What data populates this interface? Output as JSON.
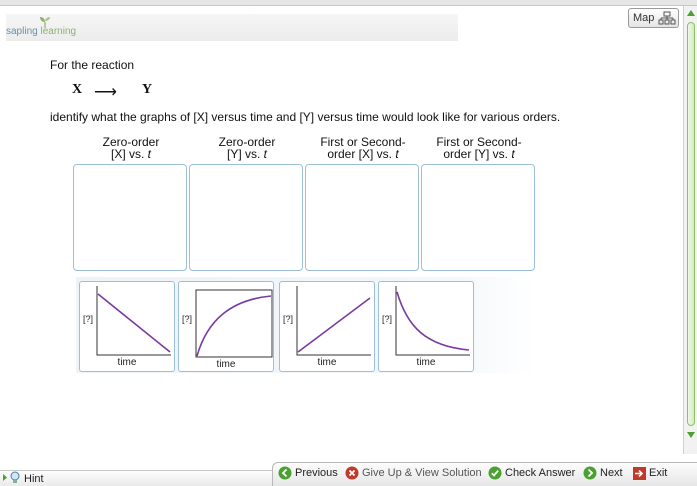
{
  "header": {
    "logo_sapling": "sapling",
    "logo_learning": "learning",
    "map_label": "Map"
  },
  "problem": {
    "prompt": "For the reaction",
    "reactant": "X",
    "arrow": "⟶",
    "product": "Y",
    "question": "identify what the graphs of [X] versus time and [Y] versus time would look like for various orders."
  },
  "columns": [
    {
      "line1": "Zero-order",
      "line2": "[X] vs. ",
      "var": "t"
    },
    {
      "line1": "Zero-order",
      "line2": "[Y] vs. ",
      "var": "t"
    },
    {
      "line1": "First or Second-",
      "line2": "order [X] vs. ",
      "var": "t"
    },
    {
      "line1": "First or Second-",
      "line2": "order [Y] vs. ",
      "var": "t"
    }
  ],
  "cards": [
    {
      "ylabel": "[?]",
      "xlabel": "time",
      "shape": "linear-decrease"
    },
    {
      "ylabel": "[?]",
      "xlabel": "time",
      "shape": "curve-increase"
    },
    {
      "ylabel": "[?]",
      "xlabel": "time",
      "shape": "linear-increase"
    },
    {
      "ylabel": "[?]",
      "xlabel": "time",
      "shape": "curve-decrease"
    }
  ],
  "footer": {
    "hint": "Hint",
    "previous": "Previous",
    "give_up": "Give Up & View Solution",
    "check_answer": "Check Answer",
    "next": "Next",
    "exit": "Exit"
  },
  "colors": {
    "curve": "#7a3aa0",
    "accent_green": "#4aa030",
    "giveup_red": "#c0392b",
    "border_blue": "#9cc0d8"
  }
}
